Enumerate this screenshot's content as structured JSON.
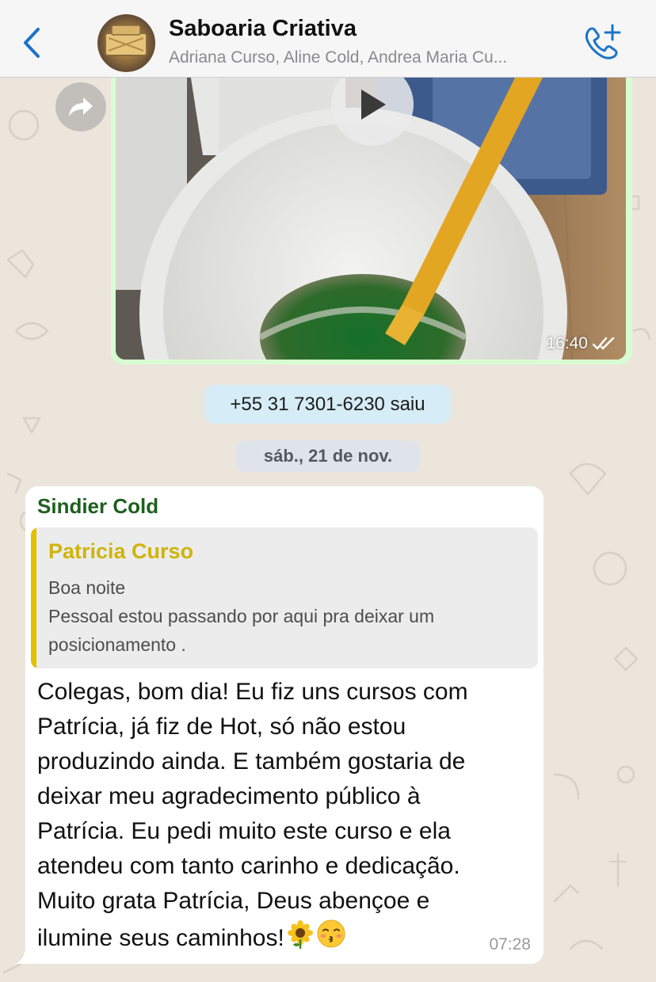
{
  "header": {
    "back_icon": "chevron-left-icon",
    "group_name": "Saboaria Criativa",
    "members": "Adriana Curso, Aline Cold, Andrea Maria Cu...",
    "call_icon": "phone-plus-icon"
  },
  "video_message": {
    "time": "16:40",
    "status_icon": "double-check-icon",
    "play_icon": "play-icon",
    "forward_icon": "forward-icon"
  },
  "system_message": "+55 31 7301-6230 saiu",
  "date_separator": "sáb., 21 de nov.",
  "text_message": {
    "sender": "Sindier Cold",
    "quoted": {
      "author": "Patricia Curso",
      "lines": [
        "Boa noite",
        "Pessoal estou passando por aqui pra deixar um",
        "posicionamento ."
      ]
    },
    "body_lines": [
      "Colegas, bom dia! Eu fiz uns cursos com",
      "Patrícia, já fiz de Hot, só não estou",
      "produzindo ainda. E também gostaria de",
      "deixar meu agradecimento público à",
      "Patrícia. Eu pedi muito este curso e ela",
      "atendeu com tanto carinho e dedicação.",
      "Muito grata Patrícia, Deus abençoe e",
      "ilumine seus caminhos!"
    ],
    "emojis": [
      "sunflower-icon",
      "kissing-face-icon"
    ],
    "time": "07:28"
  },
  "colors": {
    "accent_blue": "#1a74c7",
    "outgoing_bubble": "#d9fdd3",
    "sender_name": "#1e5f1e",
    "quote_author": "#cfb40b",
    "quote_bar": "#e4c000"
  }
}
